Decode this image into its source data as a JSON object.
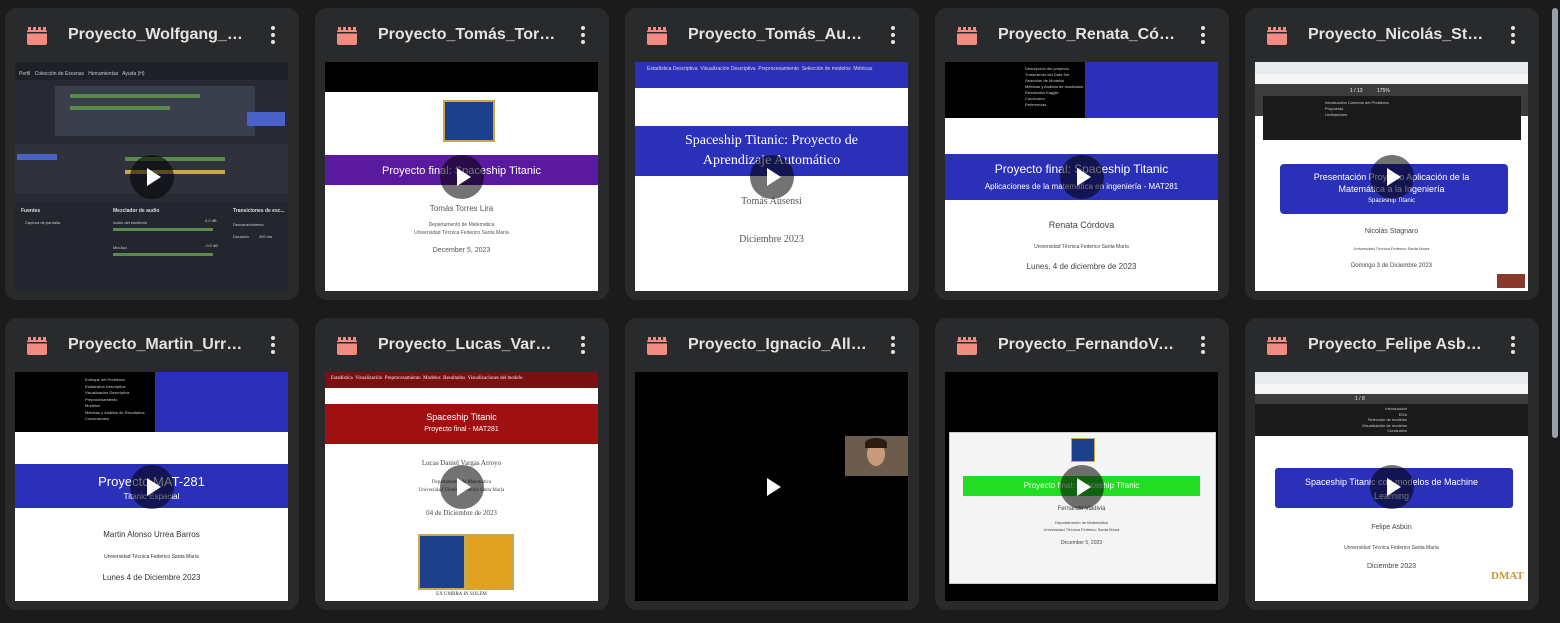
{
  "videos": [
    {
      "title": "Proyecto_Wolfgang_Br...",
      "slide": {
        "menu": [
          "Perfil",
          "Colección de Escenas",
          "Herramientas",
          "Ayuda (H)"
        ],
        "panel_labels": [
          "Fuentes",
          "Mezclador de audio",
          "Transiciones de esc..."
        ],
        "source": "Captura de pantalla",
        "audio_1": "Audio del escritorio",
        "audio_2": "Mic/Aux",
        "level_1": "0.0 dB",
        "level_2": "-0.0 dB",
        "transition": "Desvanecimiento",
        "duration_label": "Duración",
        "duration": "300 ms"
      }
    },
    {
      "title": "Proyecto_Tomás_Torre...",
      "slide": {
        "banner": "Proyecto final: Spaceship Titanic",
        "author": "Tomás Torres Lira",
        "affil_1": "Departamento de Matemática",
        "affil_2": "Universidad Técnica Federico Santa María",
        "date": "December 5, 2023"
      }
    },
    {
      "title": "Proyecto_Tomás_Ause...",
      "slide": {
        "nav": [
          "Estadística Descriptiva",
          "Visualización Descriptiva",
          "Preprocesamiento",
          "Selección de modelos",
          "Métricas"
        ],
        "banner_1": "Spaceship Titanic: Proyecto de",
        "banner_2": "Aprendizaje Automático",
        "author": "Tomás Ausensi",
        "date": "Diciembre 2023"
      }
    },
    {
      "title": "Proyecto_Renata_Córd...",
      "slide": {
        "toc": [
          "Descripción del proyecto",
          "Tratamiento del Data Set",
          "Selección de Modelos",
          "Métricas y Análisis de resultados",
          "Resultados Kaggle",
          "Conclusión",
          "Referencias"
        ],
        "banner_1": "Proyecto final: Spaceship Titanic",
        "banner_2": "Aplicaciones de la matemática en ingeniería - MAT281",
        "author": "Renata Córdova",
        "affil": "Universidad Técnica Federico Santa María",
        "date": "Lunes, 4 de diciembre de 2023"
      }
    },
    {
      "title": "Proyecto_Nicolás_Stag...",
      "slide": {
        "toc": [
          "Introducción Contexto del Problema",
          "Propuesta",
          "Limitaciones"
        ],
        "page": "1 / 13",
        "zoom": "175%",
        "banner_1": "Presentación Proyecto Aplicación de la",
        "banner_2": "Matemática a la Ingeniería",
        "banner_3": "Spaceship Titanic",
        "author": "Nicolás Stagnaro",
        "affil": "Universidad Técnica Federico Santa María",
        "date": "Domingo 3 de Diciembre 2023"
      }
    },
    {
      "title": "Proyecto_Martin_Urre...",
      "slide": {
        "toc": [
          "Enfoque del Problema",
          "Estadística Descriptiva",
          "Visualización Descriptiva",
          "Preprocesamiento",
          "Modelos",
          "Métricas y Análisis de Resultados",
          "Conclusiones"
        ],
        "banner_1": "Proyecto MAT-281",
        "banner_2": "Titanic Espacial",
        "author": "Martin Alonso Urrea Barros",
        "affil": "Universidad Técnica Federico Santa María",
        "date": "Lunes 4 de Diciembre 2023"
      }
    },
    {
      "title": "Proyecto_Lucas_Varga...",
      "slide": {
        "nav": [
          "Estadística",
          "Visualización",
          "Preprocesamiento",
          "Modelos",
          "Resultados",
          "Visualizaciones del modelo"
        ],
        "banner_1": "Spaceship Titanic",
        "banner_2": "Proyecto final - MAT281",
        "author": "Lucas Daniel Vargas Arroyo",
        "affil_1": "Departamento de Matemática",
        "affil_2": "Universidad Técnica Federico Santa María",
        "date": "04 de Diciembre de 2023",
        "motto": "EX UMBRA IN SOLEM"
      }
    },
    {
      "title": "Proyecto_Ignacio_Alle..."
    },
    {
      "title": "Proyecto_FernandoVal...",
      "slide": {
        "banner": "Proyecto final: Spaceship Titanic",
        "author": "Fernando Valdivia",
        "affil_1": "Departamento de Matemática",
        "affil_2": "Universidad Técnica Federico Santa María",
        "date": "December 5, 2023"
      }
    },
    {
      "title": "Proyecto_Felipe Asbun...",
      "slide": {
        "toc": [
          "Introducción",
          "EDA",
          "Selección de modelos",
          "Visualización de modelos",
          "Conclusión"
        ],
        "page": "1 / 8",
        "banner_1": "Spaceship Titanic con modelos de Machine",
        "banner_2": "Learning",
        "author": "Felipe Asbún",
        "affil": "Universidad Técnica Federico Santa María",
        "date": "Diciembre 2023",
        "logo": "DMAT"
      }
    }
  ],
  "colors": {
    "card": "#282a2c",
    "background": "#1b1b1b",
    "video_icon": "#f28b82",
    "title": "#e3e3e3"
  },
  "icons": [
    "video-file-icon",
    "more-vert-icon",
    "play-icon"
  ]
}
